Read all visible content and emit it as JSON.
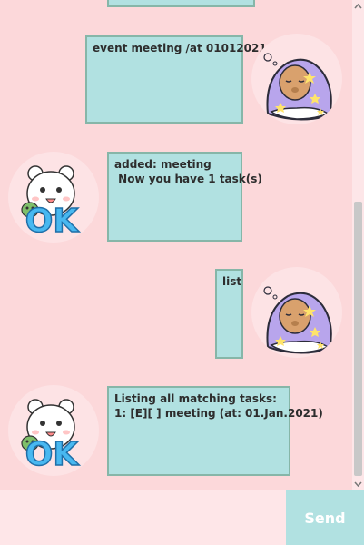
{
  "chat": {
    "messages": [
      {
        "sender": "user",
        "text": "event meeting /at 01012021"
      },
      {
        "sender": "bot",
        "text": "added: meeting\n Now you have 1 task(s)"
      },
      {
        "sender": "user",
        "text": "list"
      },
      {
        "sender": "bot",
        "text": "Listing all matching tasks:\n1: [E][ ] meeting (at: 01.Jan.2021)"
      }
    ]
  },
  "avatars": {
    "user_icon": "sleepy-bear-blanket-icon",
    "bot_icon": "white-bear-ok-icon",
    "bot_badge_text": "OK"
  },
  "input": {
    "value": "",
    "placeholder": ""
  },
  "send_button": {
    "label": "Send"
  },
  "colors": {
    "background": "#fcd8da",
    "bubble": "#b1e1e1",
    "bubble_border": "#86b6a8",
    "send_button": "#b1e1e1",
    "input": "#fee6e8"
  }
}
